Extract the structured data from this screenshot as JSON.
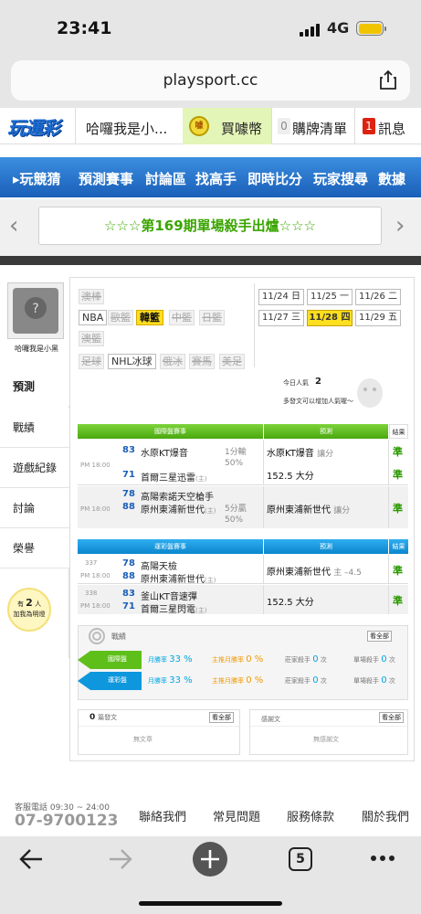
{
  "status": {
    "time": "23:41",
    "network": "4G"
  },
  "browser": {
    "url": "playsport.cc",
    "tab_count": "5"
  },
  "nav": {
    "logo": "玩運彩",
    "user": "哈囉我是小...",
    "coin_label": "買噱幣",
    "coin_icon_text": "噱",
    "cart_count": "0",
    "cart_label": "購牌清單",
    "msg_count": "1",
    "msg_label": "訊息"
  },
  "banner": {
    "tabs": [
      "玩競猜",
      "預測賽事",
      "討論區",
      "找高手",
      "即時比分",
      "玩家搜尋",
      "數據"
    ]
  },
  "promo": {
    "text": "☆☆☆第169期單場殺手出爐☆☆☆"
  },
  "sidebar": {
    "username": "哈囉我是小黑",
    "items": [
      "預測",
      "戰績",
      "遊戲紀錄",
      "討論",
      "榮譽"
    ],
    "bulb_line1": "有",
    "bulb_count": "2",
    "bulb_line1_suffix": "人",
    "bulb_line2": "加我為明燈"
  },
  "leagues": {
    "row1": [
      "澳棒"
    ],
    "row2": [
      "NBA",
      "歐籃",
      "韓籃",
      "中籃",
      "日籃"
    ],
    "row3": [
      "澳籃"
    ],
    "row4": [
      "足球",
      "NHL冰球",
      "俄冰",
      "賽馬",
      "美足"
    ]
  },
  "dates": {
    "row1": [
      "11/24 日",
      "11/25 一",
      "11/26 二"
    ],
    "row2": [
      "11/27 三",
      "11/28 四",
      "11/29 五"
    ]
  },
  "popularity": {
    "label": "今日人氣",
    "count": "2",
    "hint": "多發文可以增加人氣喔～"
  },
  "intl_table": {
    "headers": [
      "國際盤賽事",
      "預測",
      "結果"
    ],
    "games": [
      {
        "time": "PM 18:00",
        "score_a": "83",
        "team_a": "水原KT爆音",
        "score_b": "71",
        "team_b": "首爾三星迅雷",
        "tag_b": "(主)",
        "line1": "1分輸",
        "line2": "50%",
        "pick": "水原KT爆音",
        "pick_note": "讓分",
        "pick2": "152.5 大分",
        "res1": "準",
        "res2": "準"
      },
      {
        "time": "PM 18:00",
        "score_a": "78",
        "team_a": "高陽索諾天空槍手",
        "score_b": "88",
        "team_b": "原州東浦新世代",
        "tag_b": "(主)",
        "line1": "5分贏",
        "line2": "50%",
        "pick": "原州東浦新世代",
        "pick_note": "讓分",
        "res1": "準"
      }
    ]
  },
  "local_table": {
    "headers": [
      "運彩盤賽事",
      "預測",
      "結果"
    ],
    "games": [
      {
        "id": "337",
        "time": "PM 18:00",
        "score_a": "78",
        "team_a": "高陽天檢",
        "score_b": "88",
        "team_b": "原州東浦新世代",
        "tag_b": "(主)",
        "pick": "原州東浦新世代",
        "pick_note": "主 –4.5",
        "res1": "準"
      },
      {
        "id": "338",
        "time": "PM 18:00",
        "score_a": "83",
        "team_a": "釜山KT音速彈",
        "score_b": "71",
        "team_b": "首爾三星閃電",
        "tag_b": "(主)",
        "pick": "152.5 大分",
        "res1": "準"
      }
    ]
  },
  "record": {
    "title": "戰績",
    "view_all": "看全部",
    "rows": [
      {
        "label": "國際盤",
        "color": "#5fbf1a",
        "month_win": "月勝率",
        "month_pct": "33 %",
        "main_win": "主推月勝率",
        "main_pct": "0 %",
        "zhuang": "莊家殺手",
        "zhuang_n": "0",
        "single": "單場殺手",
        "single_n": "0",
        "unit": "次"
      },
      {
        "label": "運彩盤",
        "color": "#0e97dd",
        "month_win": "月勝率",
        "month_pct": "33 %",
        "main_win": "主推月勝率",
        "main_pct": "0 %",
        "zhuang": "莊家殺手",
        "zhuang_n": "0",
        "single": "單場殺手",
        "single_n": "0",
        "unit": "次"
      }
    ]
  },
  "posts": {
    "count": "0",
    "label": "篇發文",
    "view_all": "看全部",
    "empty": "無文章"
  },
  "thanks": {
    "label": "感謝文",
    "view_all": "看全部",
    "empty": "無感謝文"
  },
  "footer": {
    "service_label": "客服電話 09:30 ~ 24:00",
    "phone": "07-9700123",
    "links": [
      "聯絡我們",
      "常見問題",
      "服務條款",
      "關於我們"
    ]
  },
  "colors": {
    "blue": "#1a5fb8",
    "green": "#5fbf1a",
    "cyan": "#0e97dd",
    "yellow": "#ffdf1e"
  }
}
